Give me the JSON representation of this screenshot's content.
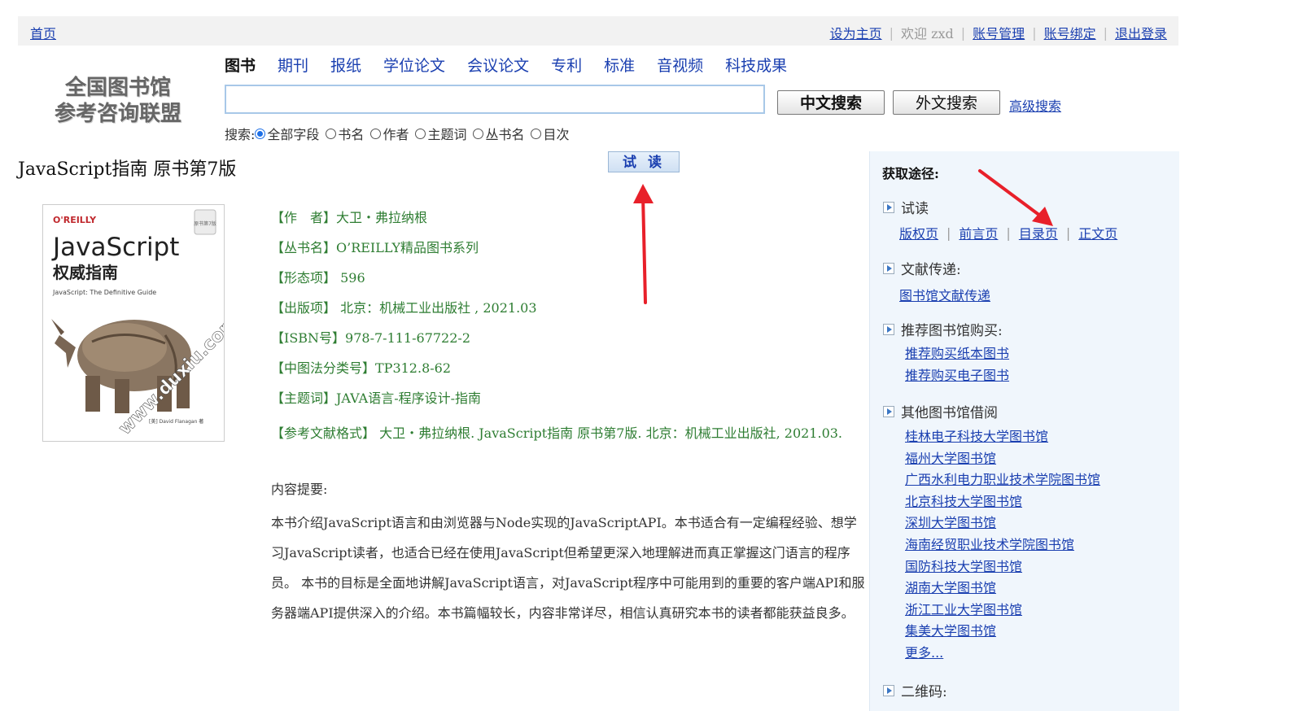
{
  "topbar": {
    "home": "首页",
    "set_home": "设为主页",
    "welcome": "欢迎 zxd",
    "account_manage": "账号管理",
    "account_bind": "账号绑定",
    "logout": "退出登录"
  },
  "logo": {
    "line1": "全国图书馆",
    "line2": "参考咨询联盟"
  },
  "tabs": [
    "图书",
    "期刊",
    "报纸",
    "学位论文",
    "会议论文",
    "专利",
    "标准",
    "音视频",
    "科技成果"
  ],
  "search": {
    "value": "",
    "cn_button": "中文搜索",
    "foreign_button": "外文搜索",
    "advanced": "高级搜索",
    "label": "搜索:",
    "options": [
      "全部字段",
      "书名",
      "作者",
      "主题词",
      "丛书名",
      "目次"
    ],
    "selected": "全部字段"
  },
  "book": {
    "title": "JavaScript指南 原书第7版",
    "trial_button": "试 读",
    "cover": {
      "publisher": "O'REILLY",
      "badge": "原书第7版",
      "main": "JavaScript",
      "cn": "权威指南",
      "subtitle": "JavaScript: The Definitive Guide",
      "watermark": "www.duxiu.com",
      "author": "[美] David Flanagan 著"
    },
    "author": "【作　者】大卫・弗拉纳根",
    "series": "【丛书名】O’REILLY精品图书系列",
    "pages": "【形态项】 596",
    "publish": "【出版项】 北京：机械工业出版社 , 2021.03",
    "isbn": "【ISBN号】978-7-111-67722-2",
    "clc": "【中图法分类号】TP312.8-62",
    "subject": "【主题词】JAVA语言-程序设计-指南",
    "citation": "【参考文献格式】 大卫・弗拉纳根. JavaScript指南 原书第7版. 北京：机械工业出版社, 2021.03.",
    "summary_label": "内容提要:",
    "summary": "本书介绍JavaScript语言和由浏览器与Node实现的JavaScriptAPI。本书适合有一定编程经验、想学习JavaScript读者，也适合已经在使用JavaScript但希望更深入地理解进而真正掌握这门语言的程序员。 本书的目标是全面地讲解JavaScript语言，对JavaScript程序中可能用到的重要的客户端API和服务器端API提供深入的介绍。本书篇幅较长，内容非常详尽，相信认真研究本书的读者都能获益良多。"
  },
  "panel": {
    "heading": "获取途径:",
    "trial": {
      "label": "试读",
      "links": [
        "版权页",
        "前言页",
        "目录页",
        "正文页"
      ]
    },
    "delivery": {
      "label": "文献传递:",
      "link": "图书馆文献传递"
    },
    "recommend": {
      "label": "推荐图书馆购买:",
      "links": [
        "推荐购买纸本图书",
        "推荐购买电子图书"
      ]
    },
    "other": {
      "label": "其他图书馆借阅",
      "links": [
        "桂林电子科技大学图书馆",
        "福州大学图书馆",
        "广西水利电力职业技术学院图书馆",
        "北京科技大学图书馆",
        "深圳大学图书馆",
        "海南经贸职业技术学院图书馆",
        "国防科技大学图书馆",
        "湖南大学图书馆",
        "浙江工业大学图书馆",
        "集美大学图书馆",
        "更多..."
      ]
    },
    "qrcode": {
      "label": "二维码:"
    }
  },
  "colors": {
    "link": "#1a3fb0",
    "meta_green": "#2e7d32",
    "panel_bg": "#f0f6fc",
    "arrow_red": "#e8202a"
  },
  "icons": [
    "triangle-right-icon",
    "radio-icon",
    "arrow-annotation-icon"
  ]
}
